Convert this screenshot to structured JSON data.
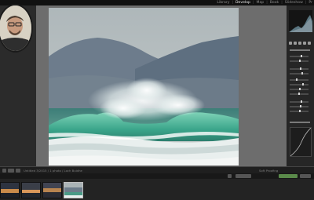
{
  "top_bar": {
    "modules": [
      "Library",
      "Develop",
      "Map",
      "Book",
      "Slideshow",
      "Pr"
    ],
    "active_module": "Develop"
  },
  "toolbar": {
    "caption": "Untitled 3/2015 / 1 photo / Loch Buidhe",
    "soft_proofing": "Soft Proofing"
  },
  "colors": {
    "background": "#3a3a3a",
    "canvas": "#6d6d6d",
    "panel": "#262626",
    "active_text": "#f0f0f0"
  }
}
